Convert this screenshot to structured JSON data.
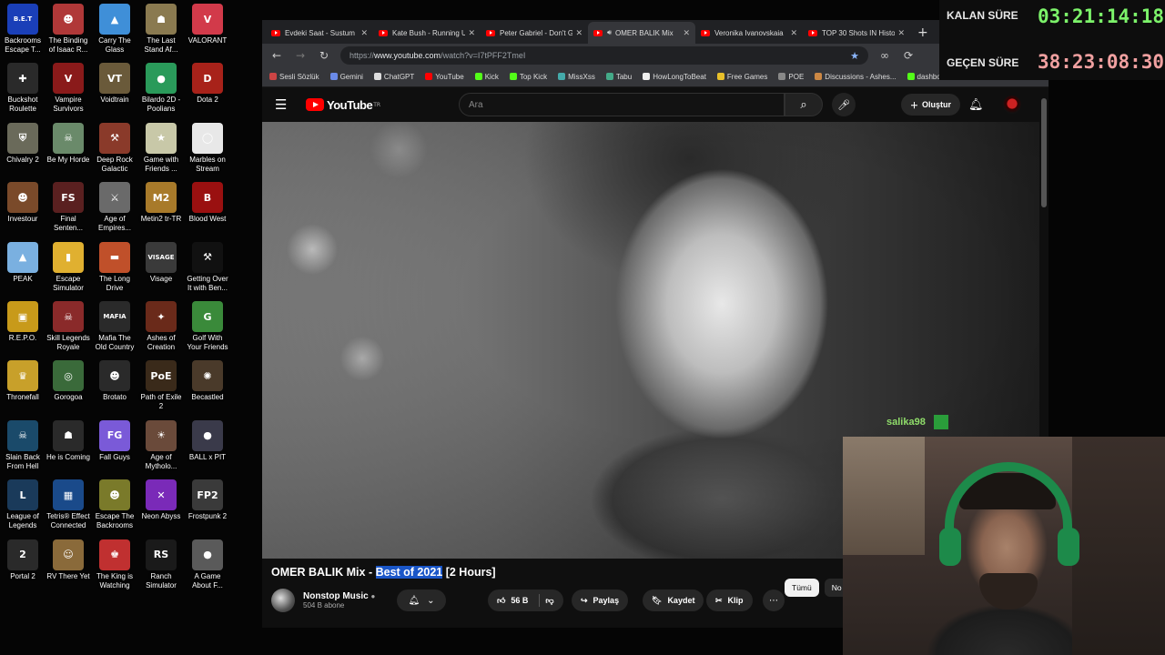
{
  "desktop": {
    "icons": [
      {
        "label": "Backrooms Escape T...",
        "color": "#1a3fb8",
        "glyph": "B.E.T"
      },
      {
        "label": "The Binding of Isaac R...",
        "color": "#b03838",
        "glyph": "☻"
      },
      {
        "label": "Carry The Glass",
        "color": "#3f8fd8",
        "glyph": "▲"
      },
      {
        "label": "The Last Stand Af...",
        "color": "#8a7a50",
        "glyph": "☗"
      },
      {
        "label": "VALORANT",
        "color": "#d23a4a",
        "glyph": "V"
      },
      {
        "label": "Buckshot Roulette",
        "color": "#2a2a2a",
        "glyph": "✚"
      },
      {
        "label": "Vampire Survivors",
        "color": "#8a1a1a",
        "glyph": "V"
      },
      {
        "label": "Voidtrain",
        "color": "#6a5a3a",
        "glyph": "VT"
      },
      {
        "label": "Bilardo 2D - Poolians",
        "color": "#2a9a5a",
        "glyph": "●"
      },
      {
        "label": "Dota 2",
        "color": "#a8221a",
        "glyph": "D"
      },
      {
        "label": "Chivalry 2",
        "color": "#6a6a5a",
        "glyph": "⛨"
      },
      {
        "label": "Be My Horde",
        "color": "#6a8a6a",
        "glyph": "☠"
      },
      {
        "label": "Deep Rock Galactic",
        "color": "#8a3a2a",
        "glyph": "⚒"
      },
      {
        "label": "Game with Friends ...",
        "color": "#c8c8a8",
        "glyph": "★"
      },
      {
        "label": "Marbles on Stream",
        "color": "#e8e8e8",
        "glyph": "◯"
      },
      {
        "label": "Investour",
        "color": "#7a4a2a",
        "glyph": "☻"
      },
      {
        "label": "Final Senten...",
        "color": "#5a2020",
        "glyph": "FS"
      },
      {
        "label": "Age of Empires...",
        "color": "#6a6a6a",
        "glyph": "⚔"
      },
      {
        "label": "Metin2 tr-TR",
        "color": "#a87a2a",
        "glyph": "M2"
      },
      {
        "label": "Blood West",
        "color": "#9a1010",
        "glyph": "B"
      },
      {
        "label": "PEAK",
        "color": "#7ab0e0",
        "glyph": "▲"
      },
      {
        "label": "Escape Simulator",
        "color": "#e0b030",
        "glyph": "▮"
      },
      {
        "label": "The Long Drive",
        "color": "#c0502a",
        "glyph": "▬"
      },
      {
        "label": "Visage",
        "color": "#3a3a3a",
        "glyph": "VISAGE"
      },
      {
        "label": "Getting Over It with Ben...",
        "color": "#111111",
        "glyph": "⚒"
      },
      {
        "label": "R.E.P.O.",
        "color": "#c89a1a",
        "glyph": "▣"
      },
      {
        "label": "Skill Legends Royale",
        "color": "#8a2a2a",
        "glyph": "☠"
      },
      {
        "label": "Mafia The Old Country",
        "color": "#2a2a2a",
        "glyph": "MAFIA"
      },
      {
        "label": "Ashes of Creation",
        "color": "#6a2a1a",
        "glyph": "✦"
      },
      {
        "label": "Golf With Your Friends",
        "color": "#3a8a3a",
        "glyph": "G"
      },
      {
        "label": "Thronefall",
        "color": "#c8a02a",
        "glyph": "♛"
      },
      {
        "label": "Gorogoa",
        "color": "#3a6a3a",
        "glyph": "◎"
      },
      {
        "label": "Brotato",
        "color": "#2a2a2a",
        "glyph": "☻"
      },
      {
        "label": "Path of Exile 2",
        "color": "#3a2a1a",
        "glyph": "PoE"
      },
      {
        "label": "Becastled",
        "color": "#4a3a2a",
        "glyph": "✺"
      },
      {
        "label": "Slain Back From Hell",
        "color": "#1a4a6a",
        "glyph": "☠"
      },
      {
        "label": "He is Coming",
        "color": "#2a2a2a",
        "glyph": "☗"
      },
      {
        "label": "Fall Guys",
        "color": "#7a5ad8",
        "glyph": "FG"
      },
      {
        "label": "Age of Mytholo...",
        "color": "#6a4a3a",
        "glyph": "☀"
      },
      {
        "label": "BALL x PIT",
        "color": "#3a3a4a",
        "glyph": "●"
      },
      {
        "label": "League of Legends",
        "color": "#1a3a5a",
        "glyph": "L"
      },
      {
        "label": "Tetris® Effect Connected",
        "color": "#1a4a8a",
        "glyph": "▦"
      },
      {
        "label": "Escape The Backrooms",
        "color": "#7a7a2a",
        "glyph": "☻"
      },
      {
        "label": "Neon Abyss",
        "color": "#7a2ab8",
        "glyph": "✕"
      },
      {
        "label": "Frostpunk 2",
        "color": "#3a3a3a",
        "glyph": "FP2"
      },
      {
        "label": "Portal 2",
        "color": "#2a2a2a",
        "glyph": "2"
      },
      {
        "label": "RV There Yet",
        "color": "#8a6a3a",
        "glyph": "☺"
      },
      {
        "label": "The King is Watching",
        "color": "#c03030",
        "glyph": "♚"
      },
      {
        "label": "Ranch Simulator",
        "color": "#1a1a1a",
        "glyph": "RS"
      },
      {
        "label": "A Game About F...",
        "color": "#5a5a5a",
        "glyph": "●"
      }
    ]
  },
  "browser": {
    "tabs": [
      {
        "title": "Evdeki Saat - Sustum"
      },
      {
        "title": "Kate Bush - Running U"
      },
      {
        "title": "Peter Gabriel - Don't G"
      },
      {
        "title": "OMER BALIK Mix",
        "active": true
      },
      {
        "title": "Veronika Ivanovskaia"
      },
      {
        "title": "TOP 30 Shots IN Histo"
      }
    ],
    "new_tab": "+",
    "url_prefix": "https://",
    "url_host": "www.youtube.com",
    "url_path": "/watch?v=I7tPFF2TmeI",
    "bookmarks": [
      {
        "label": "Sesli Sözlük",
        "color": "#c44"
      },
      {
        "label": "Gemini",
        "color": "#6a8ae8"
      },
      {
        "label": "ChatGPT",
        "color": "#ddd"
      },
      {
        "label": "YouTube",
        "color": "#f00"
      },
      {
        "label": "Kick",
        "color": "#53fc18"
      },
      {
        "label": "Top Kick",
        "color": "#53fc18"
      },
      {
        "label": "MissXss",
        "color": "#4aa"
      },
      {
        "label": "Tabu",
        "color": "#4a8"
      },
      {
        "label": "HowLongToBeat",
        "color": "#eee"
      },
      {
        "label": "Free Games",
        "color": "#e8c02a"
      },
      {
        "label": "POE",
        "color": "#888"
      },
      {
        "label": "Discussions - Ashes...",
        "color": "#c84"
      },
      {
        "label": "dashboard.kick.com...",
        "color": "#53fc18"
      }
    ]
  },
  "youtube": {
    "logo_text": "YouTube",
    "logo_region": "TR",
    "search_placeholder": "Ara",
    "create_label": "Oluştur",
    "video_title_a": "OMER BALIK Mix - ",
    "video_title_sel": "Best of 2021",
    "video_title_b": " [2 Hours]",
    "channel_name": "Nonstop Music",
    "channel_subs": "504 B abone",
    "likes": "56 B",
    "share_label": "Paylaş",
    "save_label": "Kaydet",
    "clip_label": "Klip",
    "chips": [
      "Tümü",
      "No"
    ],
    "overlay_chat_user": "salika98"
  },
  "timers": {
    "remaining_label": "KALAN SÜRE",
    "remaining_value": "03:21:14:18",
    "elapsed_label": "GEÇEN SÜRE",
    "elapsed_value": "38:23:08:30",
    "color_remaining": "#7cf26a",
    "color_elapsed": "#f0a0a0"
  }
}
